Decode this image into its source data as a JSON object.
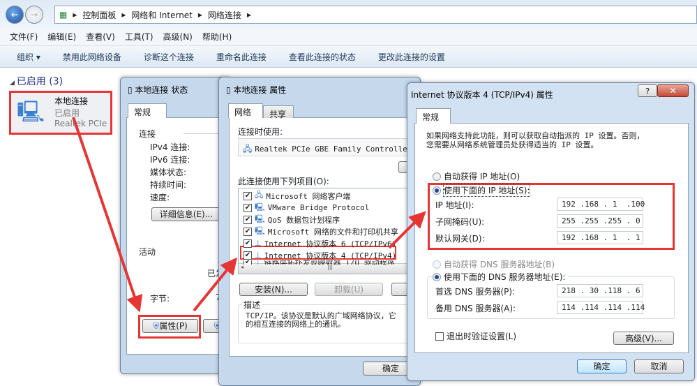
{
  "explorer": {
    "breadcrumb": [
      "控制面板",
      "网络和 Internet",
      "网络连接"
    ],
    "menu": [
      "文件(F)",
      "编辑(E)",
      "查看(V)",
      "工具(T)",
      "高级(N)",
      "帮助(H)"
    ],
    "toolbar": [
      "组织 ▾",
      "禁用此网络设备",
      "诊断这个连接",
      "重命名此连接",
      "查看此连接的状态",
      "更改此连接的设置"
    ],
    "group_header": "已启用 (3)",
    "connection": {
      "name": "本地连接",
      "status": "已启用",
      "adapter": "Realtek PCIe GBE"
    }
  },
  "status_dialog": {
    "title": "本地连接 状态",
    "tab": "常规",
    "section_connection": "连接",
    "fields": [
      "IPv4 连接:",
      "IPv6 连接:",
      "媒体状态:",
      "持续时间:",
      "速度:"
    ],
    "details_button": "详细信息(E)...",
    "section_activity": "活动",
    "sent_partial": "已发",
    "bytes_label": "字节:",
    "bytes_partial": "7",
    "properties_button": "属性(P)"
  },
  "props_dialog": {
    "title": "本地连接 属性",
    "tabs": [
      "网络",
      "共享"
    ],
    "connect_using_label": "连接时使用:",
    "adapter": "Realtek PCIe GBE Family Controller",
    "items_label": "此连接使用下列项目(O):",
    "items": [
      "Microsoft 网络客户端",
      "VMware Bridge Protocol",
      "QoS 数据包计划程序",
      "Microsoft 网络的文件和打印机共享",
      "Internet 协议版本 6 (TCP/IPv6)",
      "Internet 协议版本 4 (TCP/IPv4)",
      "链路层拓扑发现映射器 I/O 驱动程序"
    ],
    "install_button": "安装(N)...",
    "uninstall_button": "卸载(U)",
    "description_label": "描述",
    "description": "TCP/IP。该协议是默认的广域网络协议，它\n的相互连接的网络上的通讯。",
    "ok_button": "确定"
  },
  "ipv4_dialog": {
    "title": "Internet 协议版本 4 (TCP/IPv4) 属性",
    "help": "?",
    "close": "✕",
    "tab": "常规",
    "intro": "如果网络支持此功能，则可以获取自动指派的 IP 设置。否则，\n您需要从网络系统管理员处获得适当的 IP 设置。",
    "auto_ip": "自动获得 IP 地址(O)",
    "manual_ip": "使用下面的 IP 地址(S):",
    "ip_label": "IP 地址(I):",
    "ip": "192 .168 . 1  .100",
    "mask_label": "子网掩码(U):",
    "mask": "255 .255 .255 . 0",
    "gateway_label": "默认网关(D):",
    "gateway": "192 .168 . 1  . 1",
    "auto_dns": "自动获得 DNS 服务器地址(B)",
    "manual_dns": "使用下面的 DNS 服务器地址(E):",
    "dns1_label": "首选 DNS 服务器(P):",
    "dns1": "218 . 30 .118 . 6",
    "dns2_label": "备用 DNS 服务器(A):",
    "dns2": "114 .114 .114 .114",
    "validate": "退出时验证设置(L)",
    "advanced_button": "高级(V)...",
    "ok_button": "确定",
    "cancel_button": "取消"
  },
  "colors": {
    "highlight": "#e53535"
  }
}
